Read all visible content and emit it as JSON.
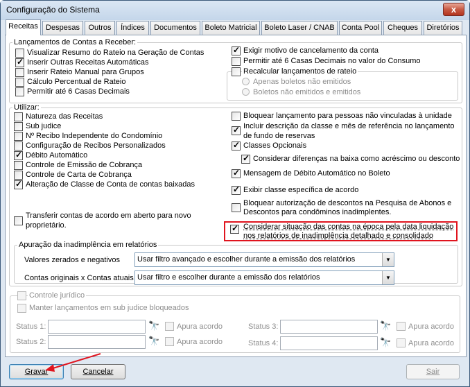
{
  "window": {
    "title": "Configuração do Sistema",
    "close_label": "x"
  },
  "tabs": [
    "Receitas",
    "Despesas",
    "Outros",
    "Índices",
    "Documentos",
    "Boleto Matricial",
    "Boleto Laser / CNAB",
    "Conta Pool",
    "Cheques",
    "Diretórios"
  ],
  "lancamentos": {
    "title": "Lançamentos de Contas a Receber:",
    "left": [
      {
        "label": "Visualizar Resumo do Rateio na Geração de Contas",
        "checked": false
      },
      {
        "label": "Inserir Outras Receitas Automáticas",
        "checked": true
      },
      {
        "label": "Inserir Rateio Manual para Grupos",
        "checked": false
      },
      {
        "label": "Cálculo Percentual de Rateio",
        "checked": false
      },
      {
        "label": "Permitir até 6 Casas Decimais",
        "checked": false
      }
    ],
    "right": [
      {
        "label": "Exigir motivo de cancelamento da conta",
        "checked": true
      },
      {
        "label": "Permitir até 6 Casas Decimais no valor do Consumo",
        "checked": false
      }
    ],
    "recalcular": {
      "label": "Recalcular lançamentos de rateio",
      "checked": false,
      "options": [
        "Apenas boletos não emitidos",
        "Boletos não emitidos e emitidos"
      ]
    }
  },
  "utilizar": {
    "title": "Utilizar:",
    "left": [
      {
        "label": "Natureza das Receitas",
        "checked": false
      },
      {
        "label": "Sub judice",
        "checked": false
      },
      {
        "label": "Nº Recibo Independente do Condomínio",
        "checked": false
      },
      {
        "label": "Configuração de Recibos Personalizados",
        "checked": false
      },
      {
        "label": "Débito Automático",
        "checked": true
      },
      {
        "label": "Controle de Emissão de Cobrança",
        "checked": false
      },
      {
        "label": "Controle de Carta de Cobrança",
        "checked": false
      },
      {
        "label": "Alteração de Classe de Conta de contas baixadas",
        "checked": true
      }
    ],
    "transferir": {
      "line1": "Transferir contas de acordo em aberto para novo",
      "line2": "proprietário.",
      "checked": false
    },
    "right": [
      {
        "line1": "Bloquear lançamento para pessoas não vinculadas à unidade",
        "line2": "",
        "checked": false
      },
      {
        "line1": "Incluir descrição da classe e mês de referência no lançamento",
        "line2": "de fundo de reservas",
        "checked": true
      },
      {
        "line1": "Classes Opcionais",
        "line2": "",
        "checked": true
      },
      {
        "line1": "Considerar diferenças na baixa como acréscimo ou desconto",
        "line2": "",
        "checked": true
      },
      {
        "line1": "Mensagem de Débito Automático no Boleto",
        "line2": "",
        "checked": true
      },
      {
        "line1": "Exibir classe específica de acordo",
        "line2": "",
        "checked": true
      },
      {
        "line1": "Bloquear autorização de descontos na Pesquisa de Abonos e",
        "line2": "Descontos para condôminos inadimplentes.",
        "checked": false
      },
      {
        "line1": "Considerar situação das contas na época pela data liquidação",
        "line2": "nos relatórios de inadimplência detalhado e consolidado",
        "checked": true
      }
    ]
  },
  "apuracao": {
    "title": "Apuração da inadimplência em relatórios",
    "rows": [
      {
        "label": "Valores zerados e negativos",
        "value": "Usar filtro avançado e escolher durante a emissão dos relatórios"
      },
      {
        "label": "Contas originais x Contas atuais",
        "value": "Usar filtro e escolher durante a emissão dos relatórios"
      }
    ]
  },
  "controle": {
    "title": "Controle jurídico",
    "manter": "Manter lançamentos em sub judice bloqueados",
    "status": [
      {
        "label": "Status 1:",
        "value": "",
        "apura": "Apura acordo"
      },
      {
        "label": "Status 2:",
        "value": "",
        "apura": "Apura acordo"
      },
      {
        "label": "Status 3:",
        "value": "",
        "apura": "Apura acordo"
      },
      {
        "label": "Status 4:",
        "value": "",
        "apura": "Apura acordo"
      }
    ]
  },
  "buttons": {
    "gravar": "Gravar",
    "cancelar": "Cancelar",
    "sair": "Sair"
  },
  "colors": {
    "highlight": "#e0141e",
    "panel_bg": "#ffffff",
    "window_bg": "#dfe8f2"
  },
  "icons": {
    "binoculars": "search-binoculars-icon",
    "arrow": "red-annotation-arrow"
  }
}
